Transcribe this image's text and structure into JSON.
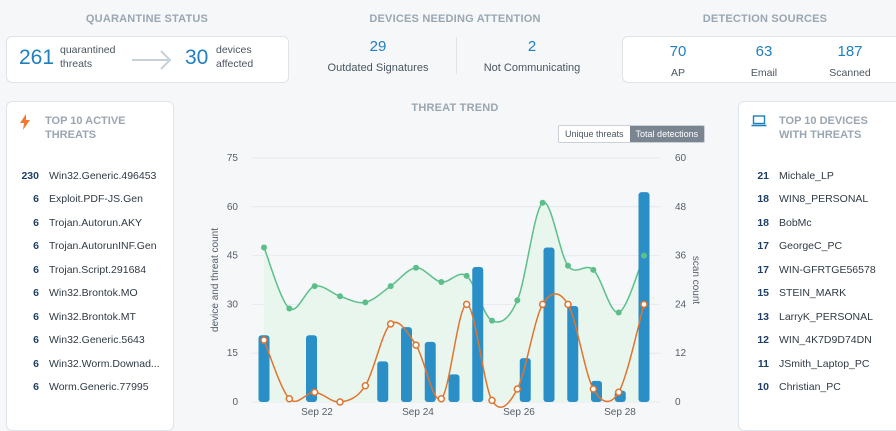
{
  "quarantine": {
    "title": "QUARANTINE STATUS",
    "threats_count": "261",
    "threats_label": "quarantined threats",
    "devices_count": "30",
    "devices_label": "devices affected",
    "arrow_icon": "arrow-right-icon"
  },
  "attention": {
    "title": "DEVICES NEEDING ATTENTION",
    "items": [
      {
        "value": "29",
        "label": "Outdated Signatures"
      },
      {
        "value": "2",
        "label": "Not Communicating"
      }
    ]
  },
  "sources": {
    "title": "DETECTION SOURCES",
    "items": [
      {
        "value": "70",
        "label": "AP"
      },
      {
        "value": "63",
        "label": "Email"
      },
      {
        "value": "187",
        "label": "Scanned"
      }
    ]
  },
  "top_threats": {
    "title_line1": "TOP 10 ACTIVE",
    "title_line2": "THREATS",
    "icon": "bolt-icon",
    "icon_color": "#f07a32",
    "rows": [
      {
        "count": "230",
        "name": "Win32.Generic.496453"
      },
      {
        "count": "6",
        "name": "Exploit.PDF-JS.Gen"
      },
      {
        "count": "6",
        "name": "Trojan.Autorun.AKY"
      },
      {
        "count": "6",
        "name": "Trojan.AutorunINF.Gen"
      },
      {
        "count": "6",
        "name": "Trojan.Script.291684"
      },
      {
        "count": "6",
        "name": "Win32.Brontok.MO"
      },
      {
        "count": "6",
        "name": "Win32.Brontok.MT"
      },
      {
        "count": "6",
        "name": "Win32.Generic.5643"
      },
      {
        "count": "6",
        "name": "Win32.Worm.Downad..."
      },
      {
        "count": "6",
        "name": "Worm.Generic.77995"
      }
    ]
  },
  "top_devices": {
    "title_line1": "TOP 10 DEVICES",
    "title_line2": "WITH THREATS",
    "icon": "laptop-icon",
    "icon_color": "#1f7fbf",
    "rows": [
      {
        "count": "21",
        "name": "Michale_LP"
      },
      {
        "count": "18",
        "name": "WIN8_PERSONAL"
      },
      {
        "count": "18",
        "name": "BobMc"
      },
      {
        "count": "17",
        "name": "GeorgeC_PC"
      },
      {
        "count": "17",
        "name": "WIN-GFRTGE56578"
      },
      {
        "count": "15",
        "name": "STEIN_MARK"
      },
      {
        "count": "13",
        "name": "LarryK_PERSONAL"
      },
      {
        "count": "12",
        "name": "WIN_4K7D9D74DN"
      },
      {
        "count": "11",
        "name": "JSmith_Laptop_PC"
      },
      {
        "count": "10",
        "name": "Christian_PC"
      }
    ]
  },
  "trend": {
    "title": "THREAT TREND",
    "toggle": {
      "options": [
        "Unique threats",
        "Total detections"
      ],
      "selected": "Total detections"
    }
  },
  "chart_data": {
    "type": "bar",
    "ylabel": "device and threat count",
    "y2label": "scan count",
    "ylim": [
      0,
      75
    ],
    "y2lim": [
      0,
      60
    ],
    "yticks": [
      0,
      15,
      30,
      45,
      60,
      75
    ],
    "y2ticks": [
      0,
      12,
      24,
      36,
      48,
      60
    ],
    "xtick_labels": [
      "Sep 22",
      "Sep 24",
      "Sep 26",
      "Sep 28"
    ],
    "grid": true,
    "colors": {
      "bars": "#2b8fc7",
      "area_line": "#5cbf8a",
      "area_fill": "#e9f6ee",
      "line": "#e0742f"
    },
    "series": [
      {
        "type": "bar",
        "values": [
          20.5,
          0,
          20.5,
          0,
          0,
          12.5,
          23,
          18.5,
          8.5,
          41.5,
          0,
          13.5,
          47.5,
          29.5,
          6.5,
          3.5,
          64.5
        ]
      },
      {
        "type": "area",
        "axis": "y2",
        "values": [
          38,
          23,
          28.5,
          26,
          24.5,
          28.5,
          33,
          29.5,
          31,
          20,
          25,
          49,
          33.5,
          32.5,
          22,
          36
        ]
      },
      {
        "type": "line",
        "values": [
          19,
          1,
          3,
          0,
          5,
          24,
          17.5,
          1,
          30,
          0.5,
          4,
          30,
          30,
          4,
          3,
          30
        ]
      }
    ]
  }
}
